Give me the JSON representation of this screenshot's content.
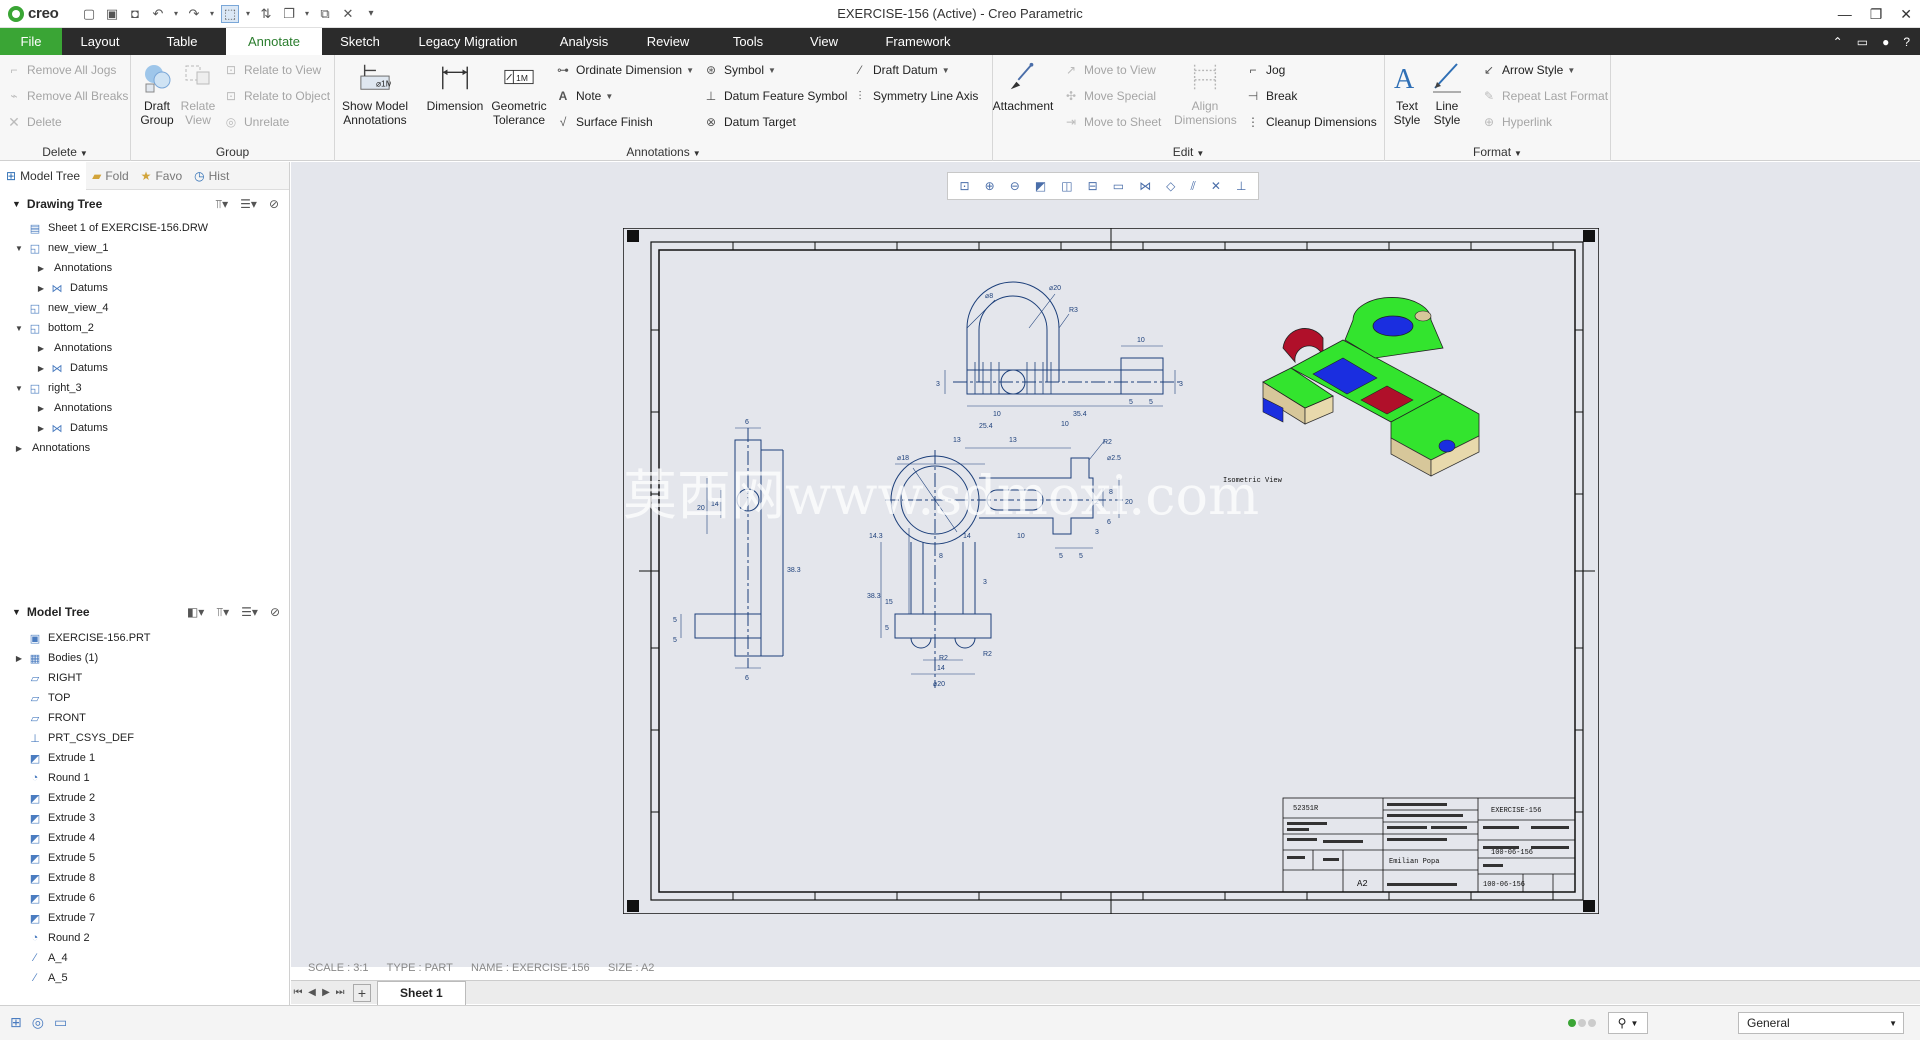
{
  "window": {
    "app_logo": "creo",
    "title": "EXERCISE-156 (Active) - Creo Parametric"
  },
  "menu": {
    "tabs": [
      "File",
      "Layout",
      "Table",
      "Annotate",
      "Sketch",
      "Legacy Migration",
      "Analysis",
      "Review",
      "Tools",
      "View",
      "Framework"
    ],
    "active": "Annotate"
  },
  "ribbon": {
    "delete_group": {
      "label": "Delete",
      "items": [
        "Remove All Jogs",
        "Remove All Breaks",
        "Delete"
      ]
    },
    "group_group": {
      "label": "Group",
      "draft_group": "Draft Group",
      "relate_view": "Relate View",
      "items": [
        "Relate to View",
        "Relate to Object",
        "Unrelate"
      ]
    },
    "annotations_group": {
      "label": "Annotations",
      "show_model": "Show Model Annotations",
      "dimension": "Dimension",
      "geometric_tolerance": "Geometric Tolerance",
      "col1": [
        "Ordinate Dimension",
        "Note",
        "Surface Finish"
      ],
      "col2": [
        "Symbol",
        "Datum Feature Symbol",
        "Datum Target"
      ],
      "col3": [
        "Draft Datum",
        "Symmetry Line Axis"
      ]
    },
    "edit_group": {
      "label": "Edit",
      "attachment": "Attachment",
      "move_items": [
        "Move to View",
        "Move Special",
        "Move to Sheet"
      ],
      "align": "Align Dimensions",
      "right_items": [
        "Jog",
        "Break",
        "Cleanup Dimensions"
      ]
    },
    "format_group": {
      "label": "Format",
      "text_style": "Text Style",
      "line_style": "Line Style",
      "items": [
        "Arrow Style",
        "Repeat Last Format",
        "Hyperlink"
      ]
    }
  },
  "left_panel": {
    "tabs": [
      "Model Tree",
      "Fold",
      "Favo",
      "Hist"
    ],
    "drawing_tree": {
      "title": "Drawing Tree",
      "items": [
        {
          "label": "Sheet 1 of EXERCISE-156.DRW",
          "level": 0,
          "toggle": "",
          "icon": "sheet-icon"
        },
        {
          "label": "new_view_1",
          "level": 0,
          "toggle": "▼",
          "icon": "view-icon"
        },
        {
          "label": "Annotations",
          "level": 1,
          "toggle": "▶",
          "icon": ""
        },
        {
          "label": "Datums",
          "level": 1,
          "toggle": "▶",
          "icon": "datum-icon"
        },
        {
          "label": "new_view_4",
          "level": 0,
          "toggle": "",
          "icon": "view-icon"
        },
        {
          "label": "bottom_2",
          "level": 0,
          "toggle": "▼",
          "icon": "view-icon"
        },
        {
          "label": "Annotations",
          "level": 1,
          "toggle": "▶",
          "icon": ""
        },
        {
          "label": "Datums",
          "level": 1,
          "toggle": "▶",
          "icon": "datum-icon"
        },
        {
          "label": "right_3",
          "level": 0,
          "toggle": "▼",
          "icon": "view-icon"
        },
        {
          "label": "Annotations",
          "level": 1,
          "toggle": "▶",
          "icon": ""
        },
        {
          "label": "Datums",
          "level": 1,
          "toggle": "▶",
          "icon": "datum-icon"
        },
        {
          "label": "Annotations",
          "level": -1,
          "toggle": "▶",
          "icon": ""
        }
      ]
    },
    "model_tree": {
      "title": "Model Tree",
      "items": [
        {
          "label": "EXERCISE-156.PRT",
          "level": -1,
          "toggle": "",
          "icon": "part-icon"
        },
        {
          "label": "Bodies (1)",
          "level": 0,
          "toggle": "▶",
          "icon": "body-icon"
        },
        {
          "label": "RIGHT",
          "level": 0,
          "toggle": "",
          "icon": "plane-icon"
        },
        {
          "label": "TOP",
          "level": 0,
          "toggle": "",
          "icon": "plane-icon"
        },
        {
          "label": "FRONT",
          "level": 0,
          "toggle": "",
          "icon": "plane-icon"
        },
        {
          "label": "PRT_CSYS_DEF",
          "level": 0,
          "toggle": "",
          "icon": "csys-icon"
        },
        {
          "label": "Extrude 1",
          "level": 0,
          "toggle": "",
          "icon": "extrude-icon"
        },
        {
          "label": "Round 1",
          "level": 0,
          "toggle": "",
          "icon": "round-icon"
        },
        {
          "label": "Extrude 2",
          "level": 0,
          "toggle": "",
          "icon": "extrude-icon"
        },
        {
          "label": "Extrude 3",
          "level": 0,
          "toggle": "",
          "icon": "extrude-icon"
        },
        {
          "label": "Extrude 4",
          "level": 0,
          "toggle": "",
          "icon": "extrude-icon"
        },
        {
          "label": "Extrude 5",
          "level": 0,
          "toggle": "",
          "icon": "extrude-icon"
        },
        {
          "label": "Extrude 8",
          "level": 0,
          "toggle": "",
          "icon": "extrude-icon"
        },
        {
          "label": "Extrude 6",
          "level": 0,
          "toggle": "",
          "icon": "extrude-icon"
        },
        {
          "label": "Extrude 7",
          "level": 0,
          "toggle": "",
          "icon": "extrude-icon"
        },
        {
          "label": "Round 2",
          "level": 0,
          "toggle": "",
          "icon": "round-icon"
        },
        {
          "label": "A_4",
          "level": 0,
          "toggle": "",
          "icon": "axis-icon"
        },
        {
          "label": "A_5",
          "level": 0,
          "toggle": "",
          "icon": "axis-icon"
        }
      ]
    }
  },
  "drawing": {
    "status_line": "SCALE : 3:1      TYPE : PART      NAME : EXERCISE-156      SIZE : A2",
    "iso_label": "Isometric View",
    "watermark": "莫西网www.sdmoxi.com",
    "title_block": {
      "name": "EXERCISE-156",
      "code": "100-06-156",
      "size": "A2",
      "author": "Emilian Popa",
      "company": "52351R"
    },
    "dims": {
      "top": [
        "⌀8",
        "⌀20",
        "R3",
        "10",
        "3",
        "35.4",
        "10",
        "5",
        "5",
        "3"
      ],
      "front": [
        "25.4",
        "13",
        "13",
        "10",
        "⌀18",
        "R2",
        "⌀2.5",
        "14.3",
        "10",
        "2",
        "6",
        "20",
        "8",
        "5",
        "5",
        "3",
        "38.3",
        "15",
        "5",
        "8",
        "14",
        "3",
        "R2",
        "R2",
        "14",
        "⌀20"
      ],
      "side": [
        "6",
        "20",
        "14",
        "38.3",
        "5",
        "5",
        "6"
      ]
    }
  },
  "sheet_tabs": {
    "tabs": [
      "Sheet 1"
    ]
  },
  "status_bar": {
    "filter": "General"
  },
  "colors": {
    "brand_green": "#3aa535",
    "menu_dark": "#2b2b2b",
    "model_green": "#33e42e",
    "model_blue": "#1a2ee0",
    "model_red": "#b0102a",
    "model_tan": "#d7c79a"
  }
}
